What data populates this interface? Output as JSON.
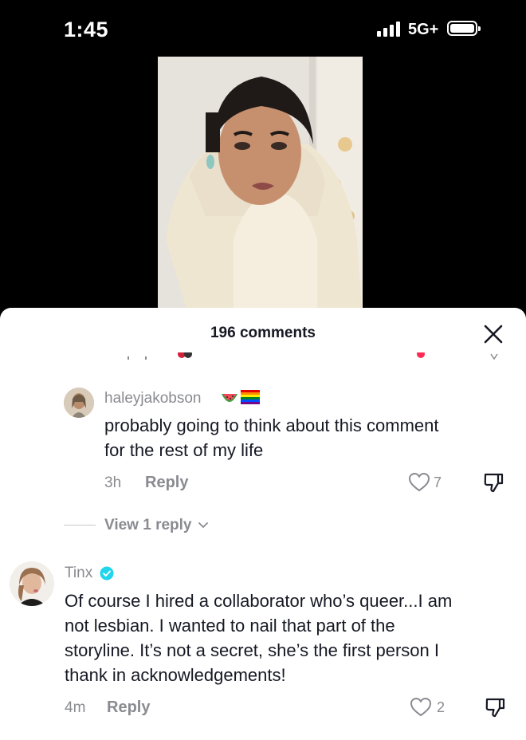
{
  "status_bar": {
    "time": "1:45",
    "network": "5G+"
  },
  "sheet": {
    "title": "196 comments"
  },
  "comments": [
    {
      "username": "haleyjakobson",
      "emojis": [
        "watermelon",
        "rainbow-flag"
      ],
      "text_lines": [
        "probably going to think about this comment",
        "for the rest of my life"
      ],
      "time": "3h",
      "reply_label": "Reply",
      "likes": "7",
      "view_replies": "View 1 reply"
    },
    {
      "username": "Tinx",
      "verified": true,
      "text_lines": [
        "Of course I hired a collaborator who’s queer...I am",
        "not lesbian. I wanted to nail that part of the",
        "storyline. It’s not a secret, she’s the first person I",
        "thank in acknowledgements!"
      ],
      "time": "4m",
      "reply_label": "Reply",
      "likes": "2"
    }
  ],
  "colors": {
    "secondary_text": "#8a8b91",
    "primary_text": "#161823",
    "verified": "#20d5ec"
  }
}
